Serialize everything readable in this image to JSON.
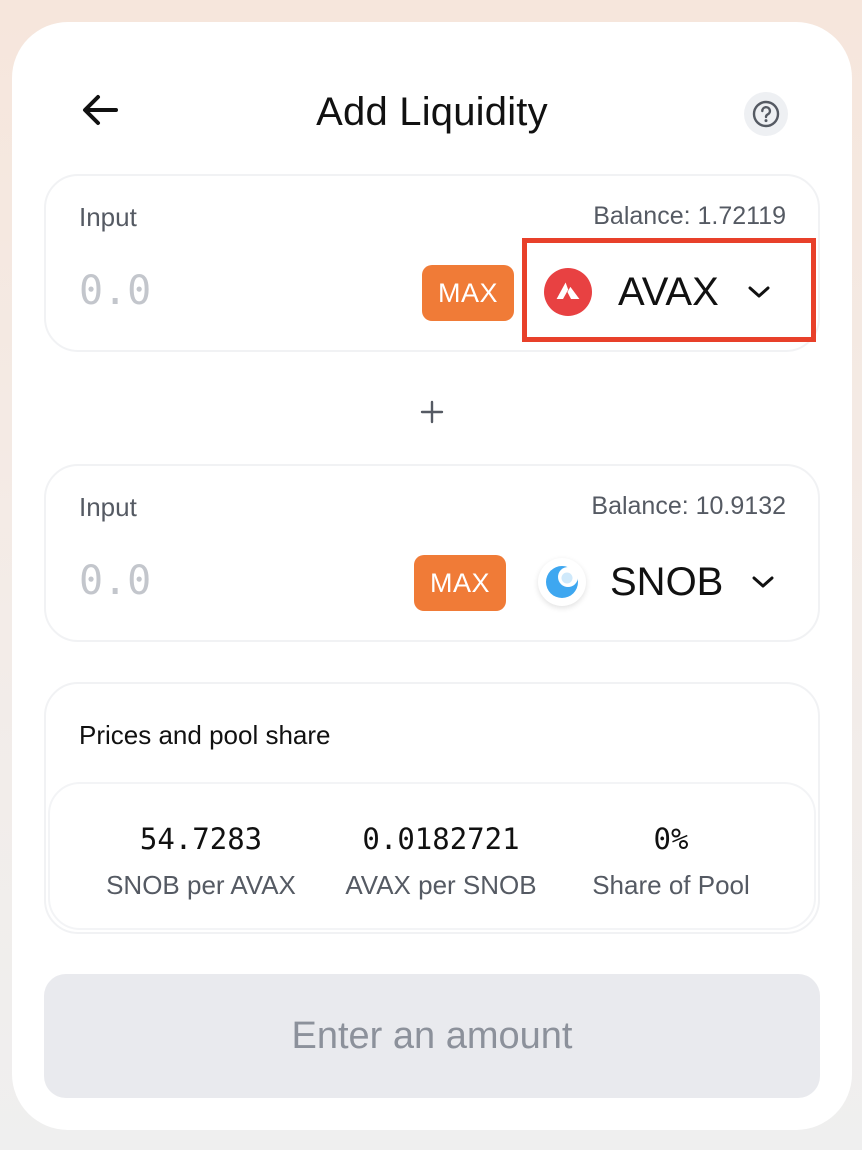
{
  "header": {
    "title": "Add Liquidity",
    "back_icon": "arrow-left-icon",
    "help_icon": "question-circle-icon"
  },
  "input_a": {
    "label": "Input",
    "balance": "Balance: 1.72119",
    "placeholder": "0.0",
    "value": "",
    "max_label": "MAX",
    "token": {
      "symbol": "AVAX",
      "logo": "avax-logo-icon",
      "color": "#e84142"
    }
  },
  "plus_icon": "plus-icon",
  "input_b": {
    "label": "Input",
    "balance": "Balance: 10.9132",
    "placeholder": "0.0",
    "value": "",
    "max_label": "MAX",
    "token": {
      "symbol": "SNOB",
      "logo": "snob-logo-icon",
      "color": "#3ea7f0"
    }
  },
  "prices": {
    "title": "Prices and pool share",
    "stats": [
      {
        "value": "54.7283",
        "label": "SNOB per AVAX"
      },
      {
        "value": "0.0182721",
        "label": "AVAX per SNOB"
      },
      {
        "value": "0%",
        "label": "Share of Pool"
      }
    ]
  },
  "submit": {
    "label": "Enter an amount",
    "disabled": true
  },
  "colors": {
    "accent_max": "#f07b37",
    "highlight_box": "#e8402a",
    "button_disabled_bg": "#e9eaee"
  }
}
